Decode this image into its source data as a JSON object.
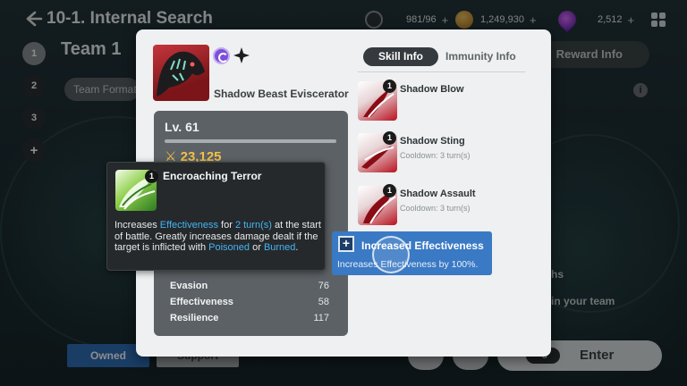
{
  "header": {
    "title": "10-1. Internal Search",
    "resources": [
      {
        "icon": "clock-stamina-icon",
        "value": "981/96"
      },
      {
        "icon": "gold-coin-icon",
        "value": "1,249,930"
      },
      {
        "icon": "purple-gem-icon",
        "value": "2,512"
      }
    ],
    "plus": "+"
  },
  "team": {
    "title": "Team 1",
    "steps": [
      "1",
      "2",
      "3",
      "+"
    ],
    "format_label": "Team Format",
    "reward_label": "Reward Info",
    "hints": [
      "ths",
      "in your team"
    ]
  },
  "bottom": {
    "owned_label": "Owned",
    "support_label": "Support",
    "enter_cost": "-8",
    "enter_label": "Enter"
  },
  "character": {
    "name": "Shadow Beast Eviscerator",
    "level": "Lv. 61",
    "power": "23,125",
    "stats": [
      {
        "name": "Evasion",
        "value": "76"
      },
      {
        "name": "Effectiveness",
        "value": "58"
      },
      {
        "name": "Resilience",
        "value": "117"
      }
    ]
  },
  "tabs": {
    "active": "Skill Info",
    "inactive": "Immunity Info"
  },
  "skills": [
    {
      "level": "1",
      "name": "Shadow Blow",
      "cooldown": ""
    },
    {
      "level": "1",
      "name": "Shadow Sting",
      "cooldown": "Cooldown: 3 turn(s)"
    },
    {
      "level": "1",
      "name": "Shadow Assault",
      "cooldown": "Cooldown: 3 turn(s)"
    }
  ],
  "effect": {
    "title": "Increased Effectiveness",
    "desc": "Increases Effectiveness by 100%."
  },
  "tooltip": {
    "level": "1",
    "title": "Encroaching Terror",
    "desc_1": "Increases ",
    "hl_1": "Effectiveness",
    "desc_2": " for ",
    "hl_2": "2 turn(s)",
    "desc_3": " at the start of battle. Greatly increases damage dealt if the target is inflicted with ",
    "hl_3": "Poisoned",
    "desc_4": " or ",
    "hl_4": "Burned",
    "desc_5": "."
  },
  "colors": {
    "accent_blue": "#3a79c4",
    "power_gold": "#f2c14a",
    "highlight": "#46b4f2",
    "element_purple": "#7d4fd8"
  }
}
